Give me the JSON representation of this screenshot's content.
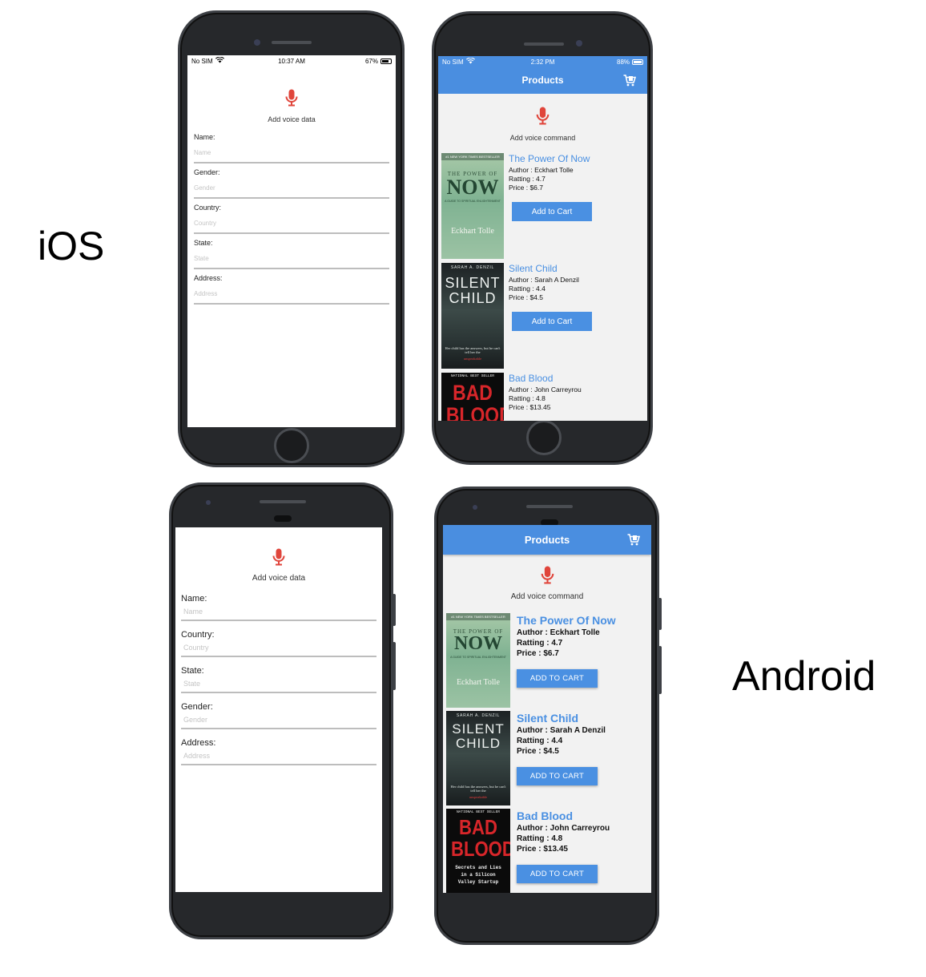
{
  "labels": {
    "ios": "iOS",
    "android": "Android"
  },
  "colors": {
    "nav_blue": "#4a8ee0",
    "link_blue": "#4a90e2",
    "mic_red": "#e0453b"
  },
  "ios_form": {
    "status": {
      "carrier": "No SIM",
      "time": "10:37 AM",
      "battery": "67%",
      "battery_level": 0.67
    },
    "mic_label": "Add voice data",
    "fields": [
      {
        "label": "Name:",
        "placeholder": "Name"
      },
      {
        "label": "Gender:",
        "placeholder": "Gender"
      },
      {
        "label": "Country:",
        "placeholder": "Country"
      },
      {
        "label": "State:",
        "placeholder": "State"
      },
      {
        "label": "Address:",
        "placeholder": "Address"
      }
    ]
  },
  "ios_products": {
    "status": {
      "carrier": "No SIM",
      "time": "2:32 PM",
      "battery": "88%",
      "battery_level": 0.88
    },
    "title": "Products",
    "mic_label": "Add voice command",
    "button_label": "Add to Cart",
    "products": [
      {
        "title": "The Power Of Now",
        "author": "Author : Eckhart Tolle",
        "rating": "Ratting : 4.7",
        "price": "Price : $6.7"
      },
      {
        "title": "Silent Child",
        "author": "Author : Sarah A Denzil",
        "rating": "Ratting : 4.4",
        "price": "Price : $4.5"
      },
      {
        "title": "Bad Blood",
        "author": "Author : John Carreyrou",
        "rating": "Ratting : 4.8",
        "price": "Price : $13.45"
      }
    ]
  },
  "android_form": {
    "mic_label": "Add voice data",
    "fields": [
      {
        "label": "Name:",
        "placeholder": "Name"
      },
      {
        "label": "Country:",
        "placeholder": "Country"
      },
      {
        "label": "State:",
        "placeholder": "State"
      },
      {
        "label": "Gender:",
        "placeholder": "Gender"
      },
      {
        "label": "Address:",
        "placeholder": "Address"
      }
    ]
  },
  "android_products": {
    "title": "Products",
    "mic_label": "Add voice command",
    "button_label": "ADD TO CART",
    "products": [
      {
        "title": "The Power Of Now",
        "author": "Author : Eckhart Tolle",
        "rating": "Ratting : 4.7",
        "price": "Price : $6.7"
      },
      {
        "title": "Silent Child",
        "author": "Author : Sarah A Denzil",
        "rating": "Ratting : 4.4",
        "price": "Price : $4.5"
      },
      {
        "title": "Bad Blood",
        "author": "Author : John Carreyrou",
        "rating": "Ratting : 4.8",
        "price": "Price : $13.45"
      }
    ]
  },
  "covers": {
    "power_of_now": {
      "banner": "#1 NEW YORK TIMES BESTSELLER",
      "pre": "THE POWER OF",
      "big": "NOW",
      "sub": "A GUIDE TO SPIRITUAL ENLIGHTENMENT",
      "author": "Eckhart Tolle"
    },
    "silent_child": {
      "author": "SARAH A. DENZIL",
      "line1": "SILENT",
      "line2": "CHILD",
      "tag": "Her child has the answers, but he can't tell her the",
      "tag_red": "unspeakable"
    },
    "bad_blood": {
      "banner": "NATIONAL BEST SELLER",
      "line1": "BAD",
      "line2": "BLOOD",
      "sub1": "Secrets and Lies",
      "sub2": "in a Silicon",
      "sub3": "Valley Startup"
    }
  }
}
